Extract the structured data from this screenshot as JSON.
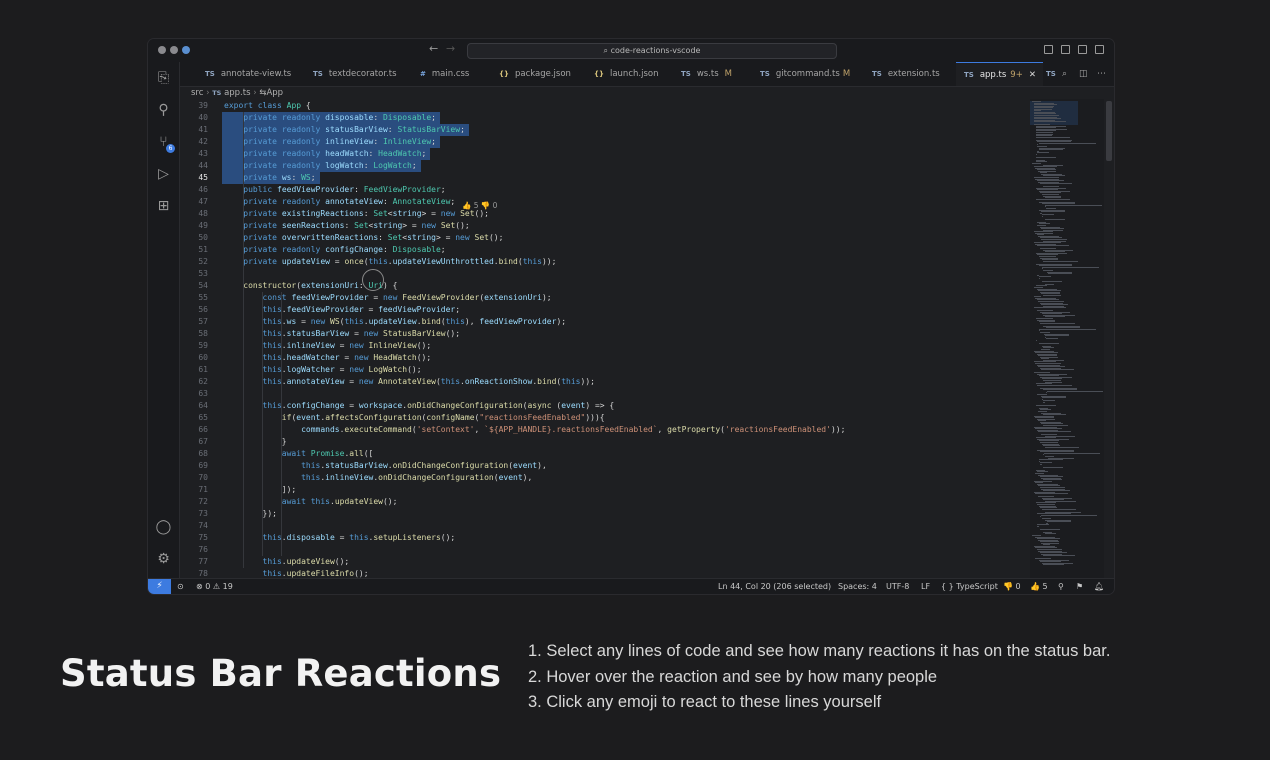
{
  "window": {
    "search_text": "code-reactions-vscode",
    "nav_back": "←",
    "nav_forward": "→"
  },
  "activity_bar": {
    "items": [
      {
        "name": "explorer-icon",
        "glyph": "⎘"
      },
      {
        "name": "search-icon",
        "glyph": "⚲"
      },
      {
        "name": "source-control-icon",
        "glyph": "⑂"
      },
      {
        "name": "run-debug-icon",
        "glyph": "▷"
      },
      {
        "name": "extensions-icon",
        "glyph": "⊞"
      }
    ],
    "source_control_badge": "6",
    "bottom": [
      {
        "name": "account-icon",
        "glyph": "◯"
      },
      {
        "name": "settings-gear-icon",
        "glyph": "⚙"
      }
    ]
  },
  "tabs": [
    {
      "icon": "TS",
      "label": "annotate-view.ts",
      "mod": ""
    },
    {
      "icon": "TS",
      "label": "textdecorator.ts",
      "mod": ""
    },
    {
      "icon": "#",
      "label": "main.css",
      "mod": ""
    },
    {
      "icon": "{}",
      "label": "package.json",
      "mod": ""
    },
    {
      "icon": "{}",
      "label": "launch.json",
      "mod": ""
    },
    {
      "icon": "TS",
      "label": "ws.ts",
      "mod": "M"
    },
    {
      "icon": "TS",
      "label": "gitcommand.ts",
      "mod": "M"
    },
    {
      "icon": "TS",
      "label": "extension.ts",
      "mod": ""
    },
    {
      "icon": "TS",
      "label": "app.ts",
      "mod": "9+"
    },
    {
      "icon": "TS",
      "label": "",
      "mod": ""
    }
  ],
  "breadcrumb": {
    "folder": "src",
    "file_icon": "TS",
    "file": "app.ts",
    "symbol_icon": "⇆",
    "symbol": "App"
  },
  "editor": {
    "first_line_number": 39,
    "current_line": 45,
    "selected_lines": [
      40,
      41,
      42,
      43,
      44,
      45
    ],
    "lines": [
      "export class App {",
      "    private readonly disposable: Disposable;",
      "    private readonly statusBarView: StatusBarView;",
      "    private readonly inlineView: InlineView;",
      "    private readonly headWatch: HeadWatch;",
      "    private readonly logWatch: LogWatch;",
      "    private ws: WS;",
      "    public feedViewProvider: FeedViewProvider;",
      "    private readonly annotateView: AnnotateView;",
      "    private existingReactions: Set<string> = new Set();",
      "    private seenReactions: Set<string> = new Set();",
      "    private overwrittenReactions: Set<string> = new Set();",
      "    private readonly configChange: Disposable;",
      "    private updateView = once(this.updateViewUnthrottled.bind(this));",
      "",
      "    constructor(extensionUri: Uri) {",
      "        const feedViewProvider = new FeedViewProvider(extensionUri);",
      "        this.feedViewProvider = feedViewProvider;",
      "        this.ws = new WS(this.updateView.bind(this), feedViewProvider);",
      "        this.statusBarView = new StatusBarView();",
      "        this.inlineView = new InlineView();",
      "        this.headWatcher = new HeadWatch();",
      "        this.logWatcher = new LogWatch();",
      "        this.annotateView = new AnnotateView(this.onReactionShow.bind(this));",
      "",
      "        this.configChange = workspace.onDidChangeConfiguration(async (event) => {",
      "            if(event.affectsConfiguration(configName(\"reactionsFeedEnabled\"))){",
      "                commands.executeCommand('setContext', `${APP_HANDLE}.reactionsFeedEnabled`, getProperty('reactionsFeedEnabled'));",
      "            }",
      "            await Promise.all([",
      "                this.statusBarView.onDidChangeConfiguration(event),",
      "                this.inlineView.onDidChangeConfiguration(event),",
      "            ]);",
      "            await this.updateView();",
      "        });",
      "",
      "        this.disposable = this.setupListeners();",
      "",
      "        this.updateView();",
      "        this.updateFileInfo();"
    ],
    "inline_reactions": "👍 5  👎 0"
  },
  "status_bar": {
    "remote_glyph": "⚡",
    "errors": "0",
    "warnings": "19",
    "position": "Ln 44, Col 20 (206 selected)",
    "spaces": "Spaces: 4",
    "encoding": "UTF-8",
    "eol": "LF",
    "language": "{ } TypeScript",
    "thumbs_down": "👎 0",
    "thumbs_up": "👍 5"
  },
  "caption": {
    "title": "Status Bar Reactions",
    "steps": [
      "1. Select any lines of code and see how many reactions it has on the status bar.",
      "2. Hover over the reaction and see by how many people",
      "3. Click any emoji to react to these lines yourself"
    ]
  }
}
